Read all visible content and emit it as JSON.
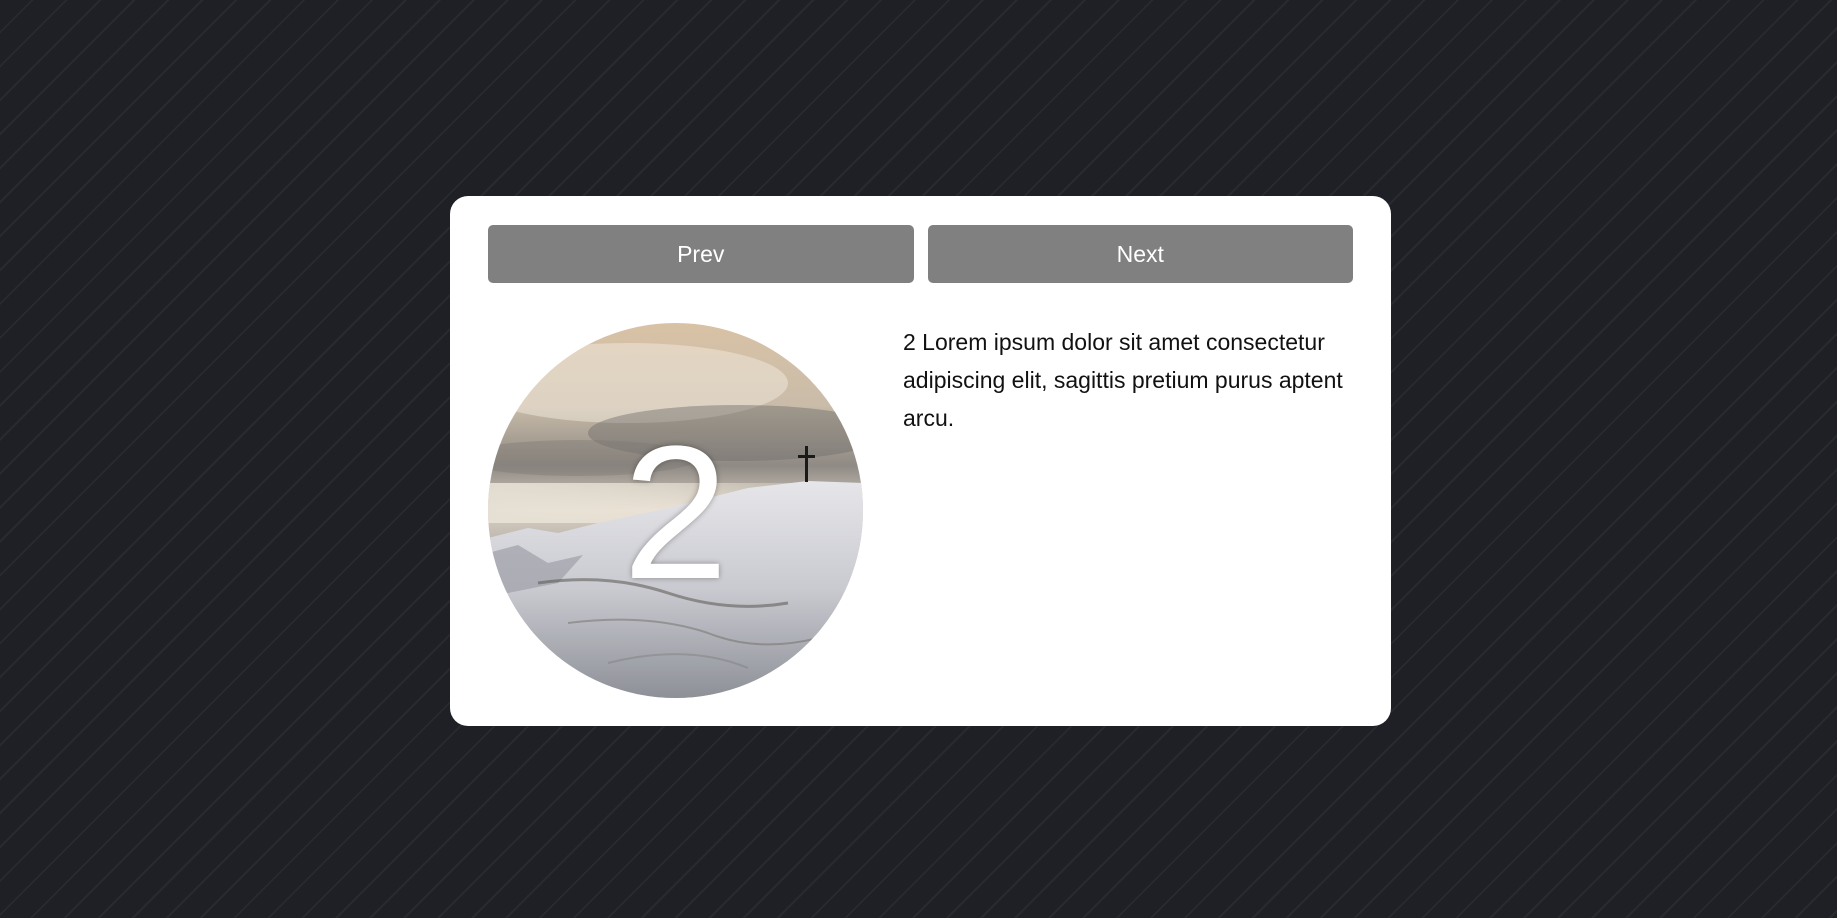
{
  "nav": {
    "prev_label": "Prev",
    "next_label": "Next"
  },
  "slide": {
    "number": "2",
    "text": "2 Lorem ipsum dolor sit amet consectetur adipiscing elit, sagittis pretium purus aptent arcu.",
    "image_subject": "snowy mountain summit with cross under cloudy sky"
  },
  "colors": {
    "background": "#1f2026",
    "card": "#ffffff",
    "button": "#808080",
    "button_text": "#ffffff"
  }
}
